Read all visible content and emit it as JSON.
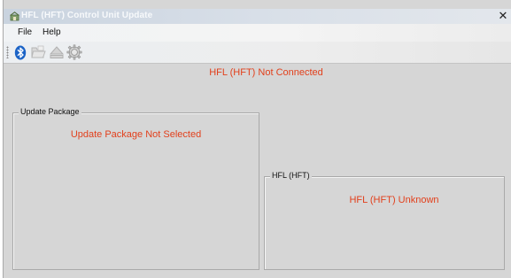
{
  "window": {
    "title": "HFL (HFT) Control Unit Update",
    "close_glyph": "✕"
  },
  "menu": {
    "items": [
      "File",
      "Help"
    ]
  },
  "toolbar": {
    "buttons": [
      "bluetooth-icon",
      "open-file-icon",
      "eject-icon",
      "settings-gear-icon"
    ]
  },
  "status": {
    "connection": "HFL (HFT) Not Connected"
  },
  "update_package": {
    "legend": "Update Package",
    "message": "Update Package Not Selected"
  },
  "hfl": {
    "legend": "HFL (HFT)",
    "message": "HFL (HFT) Unknown"
  },
  "colors": {
    "status_text": "#e2401c",
    "window_bg": "#d6d6d6"
  }
}
